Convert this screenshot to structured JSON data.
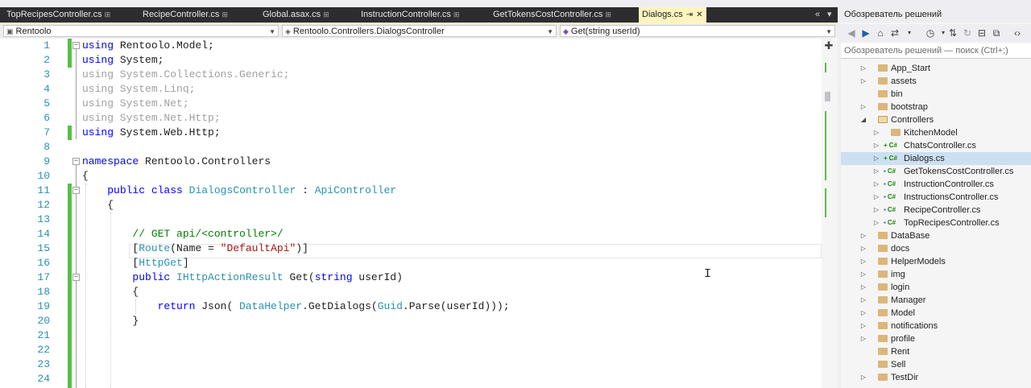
{
  "tabs": [
    {
      "label": "TopRecipesController.cs",
      "pin": "⊞"
    },
    {
      "label": "RecipeController.cs",
      "pin": "⊞"
    },
    {
      "label": "Global.asax.cs",
      "pin": "⊞"
    },
    {
      "label": "InstructionController.cs",
      "pin": "⊞"
    },
    {
      "label": "GetTokensCostController.cs",
      "pin": "⊞"
    }
  ],
  "active_tab": {
    "label": "Dialogs.cs",
    "pin": "⇥",
    "close": "✕"
  },
  "tab_controls": {
    "overflow": "«",
    "dropdown": "▾"
  },
  "nav": {
    "project": "Rentoolo",
    "class": "Rentoolo.Controllers.DialogsController",
    "member": "Get(string userId)"
  },
  "editor": {
    "line_numbers": [
      "1",
      "2",
      "3",
      "4",
      "5",
      "6",
      "7",
      "8",
      "9",
      "10",
      "11",
      "12",
      "13",
      "14",
      "15",
      "16",
      "17",
      "18",
      "19",
      "20",
      "21",
      "22",
      "23",
      "24"
    ]
  },
  "solution_explorer": {
    "title": "Обозреватель решений",
    "search_placeholder": "Обозреватель решений — поиск (Ctrl+;)",
    "toolbar_icons": [
      "back-icon",
      "forward-icon",
      "home-icon",
      "sync-icon",
      "history-icon",
      "pending-changes-icon",
      "refresh-icon",
      "collapse-all-icon",
      "show-all-files-icon",
      "code-view-icon"
    ],
    "items": [
      {
        "label": "App_Start",
        "kind": "folder",
        "expander": "▷"
      },
      {
        "label": "assets",
        "kind": "folder",
        "expander": "▷"
      },
      {
        "label": "bin",
        "kind": "folder",
        "expander": ""
      },
      {
        "label": "bootstrap",
        "kind": "folder",
        "expander": "▷"
      },
      {
        "label": "Controllers",
        "kind": "folder-open",
        "expander": "◢"
      },
      {
        "label": "KitchenModel",
        "kind": "folder",
        "expander": "▷"
      },
      {
        "label": "ChatsController.cs",
        "kind": "cs-new",
        "expander": "▷"
      },
      {
        "label": "Dialogs.cs",
        "kind": "cs-new",
        "expander": "▷"
      },
      {
        "label": "GetTokensCostController.cs",
        "kind": "cs-locked",
        "expander": "▷"
      },
      {
        "label": "InstructionController.cs",
        "kind": "cs-locked",
        "expander": "▷"
      },
      {
        "label": "InstructionsController.cs",
        "kind": "cs-locked",
        "expander": "▷"
      },
      {
        "label": "RecipeController.cs",
        "kind": "cs-locked",
        "expander": "▷"
      },
      {
        "label": "TopRecipesController.cs",
        "kind": "cs-locked",
        "expander": "▷"
      },
      {
        "label": "DataBase",
        "kind": "folder",
        "expander": "▷"
      },
      {
        "label": "docs",
        "kind": "folder",
        "expander": "▷"
      },
      {
        "label": "HelperModels",
        "kind": "folder",
        "expander": "▷"
      },
      {
        "label": "img",
        "kind": "folder",
        "expander": "▷"
      },
      {
        "label": "login",
        "kind": "folder",
        "expander": "▷"
      },
      {
        "label": "Manager",
        "kind": "folder",
        "expander": "▷"
      },
      {
        "label": "Model",
        "kind": "folder",
        "expander": "▷"
      },
      {
        "label": "notifications",
        "kind": "folder",
        "expander": "▷"
      },
      {
        "label": "profile",
        "kind": "folder",
        "expander": "▷"
      },
      {
        "label": "Rent",
        "kind": "folder",
        "expander": ""
      },
      {
        "label": "Sell",
        "kind": "folder",
        "expander": ""
      },
      {
        "label": "TestDir",
        "kind": "folder",
        "expander": "▷"
      }
    ],
    "selected": "Dialogs.cs",
    "cs_badge": "C#",
    "new_mark": "+",
    "lock_mark": "🔒"
  },
  "colors": {
    "keyword": "#0000ff",
    "type": "#2b91af",
    "comment": "#008000",
    "string": "#a31515",
    "change_bar": "#57c045",
    "active_tab": "#fdf4bf"
  }
}
